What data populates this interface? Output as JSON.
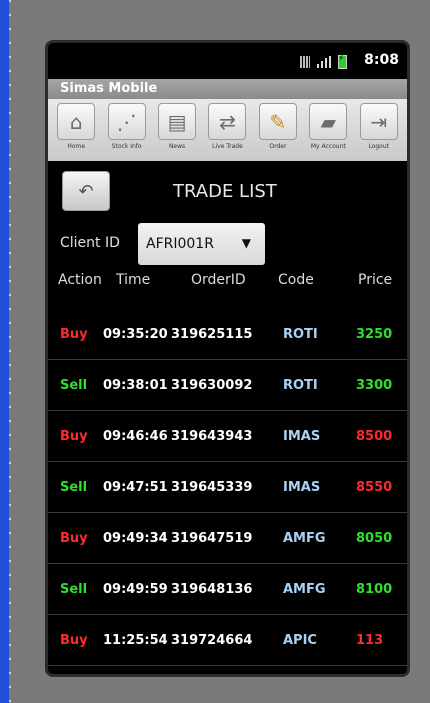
{
  "status": {
    "time": "8:08"
  },
  "app": {
    "title": "Simas Mobile"
  },
  "toolbar": [
    {
      "label": "Home",
      "icon": "home-icon"
    },
    {
      "label": "Stock Info",
      "icon": "stock-info-icon"
    },
    {
      "label": "News",
      "icon": "news-icon"
    },
    {
      "label": "Live Trade",
      "icon": "live-trade-icon"
    },
    {
      "label": "Order",
      "icon": "order-icon"
    },
    {
      "label": "My Account",
      "icon": "wallet-icon"
    },
    {
      "label": "Logout",
      "icon": "logout-icon"
    }
  ],
  "page": {
    "title": "TRADE LIST"
  },
  "client": {
    "label": "Client ID",
    "value": "AFRI001R"
  },
  "columns": {
    "action": "Action",
    "time": "Time",
    "order": "OrderID",
    "code": "Code",
    "price": "Price"
  },
  "colors": {
    "buy": "#ff2a2a",
    "sell": "#2ee02e",
    "code": "#a9d2f5"
  },
  "trades": [
    {
      "action": "Buy",
      "time": "09:35:20",
      "order": "319625115",
      "code": "ROTI",
      "price": "3250",
      "price_color": "#2ee02e"
    },
    {
      "action": "Sell",
      "time": "09:38:01",
      "order": "319630092",
      "code": "ROTI",
      "price": "3300",
      "price_color": "#2ee02e"
    },
    {
      "action": "Buy",
      "time": "09:46:46",
      "order": "319643943",
      "code": "IMAS",
      "price": "8500",
      "price_color": "#ff2a2a"
    },
    {
      "action": "Sell",
      "time": "09:47:51",
      "order": "319645339",
      "code": "IMAS",
      "price": "8550",
      "price_color": "#ff2a2a"
    },
    {
      "action": "Buy",
      "time": "09:49:34",
      "order": "319647519",
      "code": "AMFG",
      "price": "8050",
      "price_color": "#2ee02e"
    },
    {
      "action": "Sell",
      "time": "09:49:59",
      "order": "319648136",
      "code": "AMFG",
      "price": "8100",
      "price_color": "#2ee02e"
    },
    {
      "action": "Buy",
      "time": "11:25:54",
      "order": "319724664",
      "code": "APIC",
      "price": "113",
      "price_color": "#ff2a2a"
    }
  ]
}
